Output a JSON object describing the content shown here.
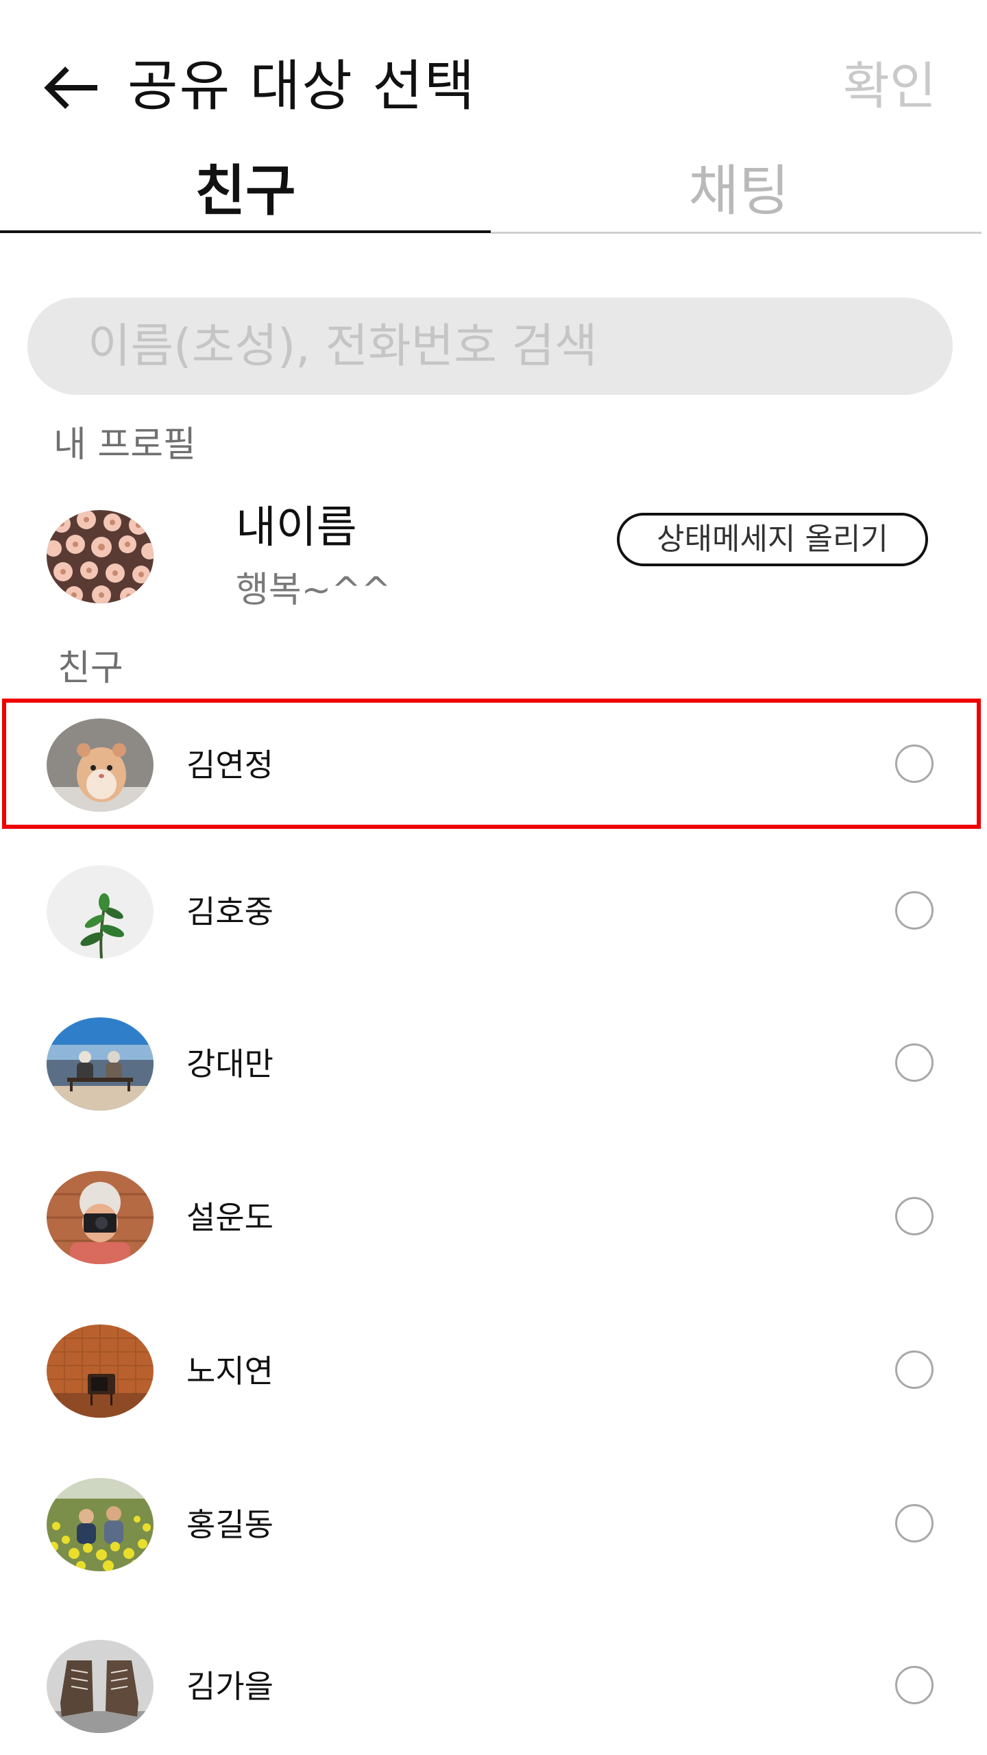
{
  "header": {
    "title": "공유 대상 선택",
    "confirm_label": "확인"
  },
  "tabs": [
    {
      "label": "친구",
      "active": true
    },
    {
      "label": "채팅",
      "active": false
    }
  ],
  "search": {
    "placeholder": "이름(초성), 전화번호 검색",
    "value": ""
  },
  "my_profile": {
    "section_label": "내 프로필",
    "name": "내이름",
    "status": "행복~^^",
    "status_button_label": "상태메세지 올리기",
    "avatar": "flowers-photo"
  },
  "friends": {
    "section_label": "친구",
    "items": [
      {
        "name": "김연정",
        "avatar": "hamster-photo",
        "selected": false
      },
      {
        "name": "김호중",
        "avatar": "plant-photo",
        "selected": false
      },
      {
        "name": "강대만",
        "avatar": "couple-on-bench-photo",
        "selected": false
      },
      {
        "name": "설운도",
        "avatar": "woman-with-camera-photo",
        "selected": false
      },
      {
        "name": "노지연",
        "avatar": "retro-tv-photo",
        "selected": false
      },
      {
        "name": "홍길동",
        "avatar": "couple-in-flowers-photo",
        "selected": false
      },
      {
        "name": "김가을",
        "avatar": "boots-photo",
        "selected": false
      }
    ]
  },
  "colors": {
    "highlight": "#ee0000",
    "inactive_text": "#c9c9c9",
    "search_background": "#e8e8e8"
  }
}
